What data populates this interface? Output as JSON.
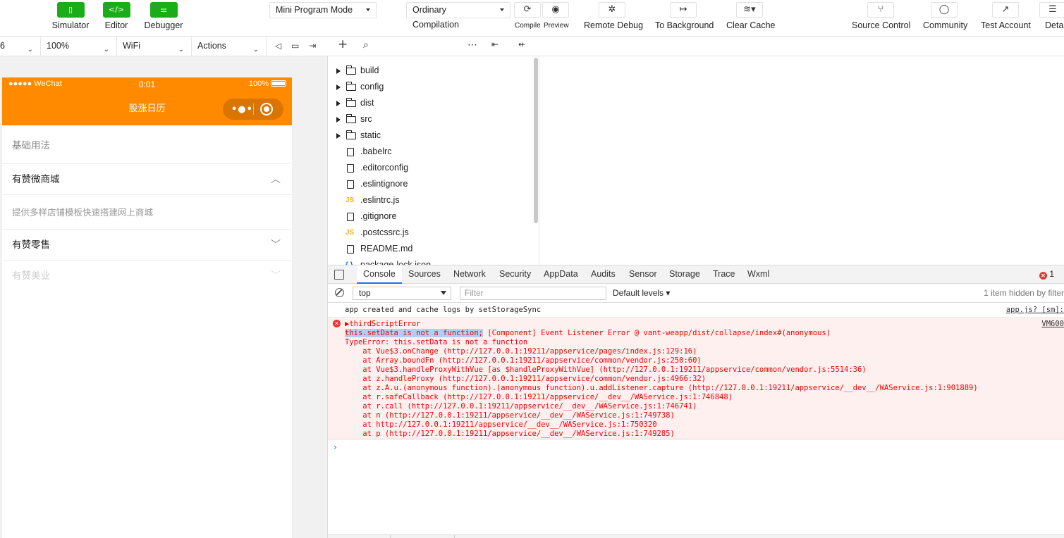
{
  "toolbar": {
    "simulator": "Simulator",
    "editor": "Editor",
    "debugger": "Debugger",
    "mode_select": "Mini Program Mode",
    "compile_select": "Ordinary Compilation",
    "compile_label": "Compile",
    "preview_label": "Preview",
    "remote_debug": "Remote Debug",
    "to_background": "To Background",
    "clear_cache": "Clear Cache",
    "source_control": "Source Control",
    "community": "Community",
    "test_account": "Test Account",
    "details": "Deta"
  },
  "simbar": {
    "device": "6",
    "zoom": "100%",
    "network": "WiFi",
    "actions": "Actions"
  },
  "phone": {
    "carrier": "●●●●● WeChat",
    "time": "0:01",
    "battery": "100%",
    "nav_title": "股涨日历",
    "rows": [
      {
        "label": "基础用法"
      },
      {
        "label": "有赞微商城"
      },
      {
        "label": "提供多样店铺模板快速搭建网上商城"
      },
      {
        "label": "有赞零售"
      },
      {
        "label": "有赞美业"
      }
    ]
  },
  "filetree": {
    "items": [
      {
        "name": "build",
        "type": "folder"
      },
      {
        "name": "config",
        "type": "folder"
      },
      {
        "name": "dist",
        "type": "folder"
      },
      {
        "name": "src",
        "type": "folder"
      },
      {
        "name": "static",
        "type": "folder"
      },
      {
        "name": ".babelrc",
        "type": "file"
      },
      {
        "name": ".editorconfig",
        "type": "file"
      },
      {
        "name": ".eslintignore",
        "type": "file"
      },
      {
        "name": ".eslintrc.js",
        "type": "js"
      },
      {
        "name": ".gitignore",
        "type": "file"
      },
      {
        "name": ".postcssrc.js",
        "type": "js"
      },
      {
        "name": "README.md",
        "type": "file"
      },
      {
        "name": "package-lock.json",
        "type": "json"
      }
    ]
  },
  "devtools": {
    "tabs": [
      "Console",
      "Sources",
      "Network",
      "Security",
      "AppData",
      "Audits",
      "Sensor",
      "Storage",
      "Trace",
      "Wxml"
    ],
    "error_count": "1",
    "context": "top",
    "filter_placeholder": "Filter",
    "levels": "Default levels ▾",
    "hidden_note": "1 item hidden by filter"
  },
  "console": {
    "log_msg": "app created and cache logs by setStorageSync",
    "log_src": "app.js? [sm]:",
    "err_title": "▶thirdScriptError",
    "err_src": "VM600",
    "err_highlight": "this.setData is not a function;",
    "err_rest": " [Component] Event Listener Error @ vant-weapp/dist/collapse/index#(anonymous)",
    "type_error": "TypeError: this.setData is not a function",
    "stack": [
      {
        "prefix": "    at Vue$3.onChange (",
        "link": "http://127.0.0.1:19211/appservice/pages/index.js:129:16",
        "suffix": ")"
      },
      {
        "prefix": "    at Array.boundFn (",
        "link": "http://127.0.0.1:19211/appservice/common/vendor.js:250:60",
        "suffix": ")"
      },
      {
        "prefix": "    at Vue$3.handleProxyWithVue [as $handleProxyWithVue] (",
        "link": "http://127.0.0.1:19211/appservice/common/vendor.js:5514:36",
        "suffix": ")"
      },
      {
        "prefix": "    at z.handleProxy (",
        "link": "http://127.0.0.1:19211/appservice/common/vendor.js:4966:32",
        "suffix": ")"
      },
      {
        "prefix": "    at z.A.u.(anonymous function).(anonymous function).u.addListener.capture (",
        "link": "http://127.0.0.1:19211/appservice/__dev__/WAService.js:1:901889",
        "suffix": ")"
      },
      {
        "prefix": "    at r.safeCallback (",
        "link": "http://127.0.0.1:19211/appservice/__dev__/WAService.js:1:746848",
        "suffix": ")"
      },
      {
        "prefix": "    at r.call (",
        "link": "http://127.0.0.1:19211/appservice/__dev__/WAService.js:1:746741",
        "suffix": ")"
      },
      {
        "prefix": "    at n (",
        "link": "http://127.0.0.1:19211/appservice/__dev__/WAService.js:1:749738",
        "suffix": ")"
      },
      {
        "prefix": "    at ",
        "link": "http://127.0.0.1:19211/appservice/__dev__/WAService.js:1:750320",
        "suffix": ""
      },
      {
        "prefix": "    at p (",
        "link": "http://127.0.0.1:19211/appservice/__dev__/WAService.js:1:749285",
        "suffix": ")"
      }
    ]
  }
}
